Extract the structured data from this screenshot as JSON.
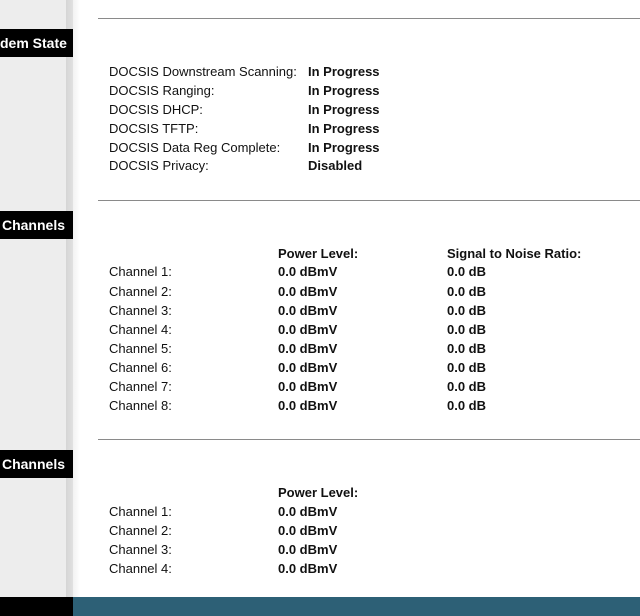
{
  "sections": {
    "modem_state_label": "dem State",
    "downstream_label": "Channels",
    "upstream_label": "Channels"
  },
  "modem_state": [
    {
      "label": "DOCSIS Downstream Scanning:",
      "value": "In Progress"
    },
    {
      "label": "DOCSIS Ranging:",
      "value": "In Progress"
    },
    {
      "label": "DOCSIS DHCP:",
      "value": "In Progress"
    },
    {
      "label": "DOCSIS TFTP:",
      "value": "In Progress"
    },
    {
      "label": "DOCSIS Data Reg Complete:",
      "value": "In Progress"
    },
    {
      "label": "DOCSIS Privacy:",
      "value": "Disabled"
    }
  ],
  "downstream": {
    "headers": {
      "power": "Power Level:",
      "snr": "Signal to Noise Ratio:"
    },
    "rows": [
      {
        "channel": "Channel 1:",
        "power": "0.0 dBmV",
        "snr": "0.0 dB"
      },
      {
        "channel": "Channel 2:",
        "power": "0.0 dBmV",
        "snr": "0.0 dB"
      },
      {
        "channel": "Channel 3:",
        "power": "0.0 dBmV",
        "snr": "0.0 dB"
      },
      {
        "channel": "Channel 4:",
        "power": "0.0 dBmV",
        "snr": "0.0 dB"
      },
      {
        "channel": "Channel 5:",
        "power": "0.0 dBmV",
        "snr": "0.0 dB"
      },
      {
        "channel": "Channel 6:",
        "power": "0.0 dBmV",
        "snr": "0.0 dB"
      },
      {
        "channel": "Channel 7:",
        "power": "0.0 dBmV",
        "snr": "0.0 dB"
      },
      {
        "channel": "Channel 8:",
        "power": "0.0 dBmV",
        "snr": "0.0 dB"
      }
    ]
  },
  "upstream": {
    "headers": {
      "power": "Power Level:"
    },
    "rows": [
      {
        "channel": "Channel 1:",
        "power": "0.0 dBmV"
      },
      {
        "channel": "Channel 2:",
        "power": "0.0 dBmV"
      },
      {
        "channel": "Channel 3:",
        "power": "0.0 dBmV"
      },
      {
        "channel": "Channel 4:",
        "power": "0.0 dBmV"
      }
    ]
  },
  "colors": {
    "footer_bar": "#2d6076",
    "section_label_bg": "#000000",
    "sidebar_bg": "#ededed"
  }
}
